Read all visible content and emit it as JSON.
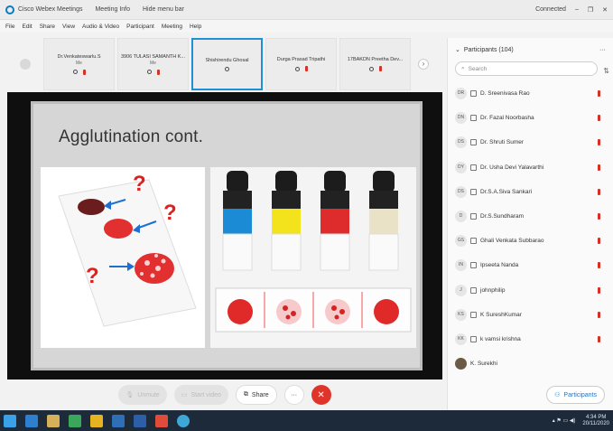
{
  "window": {
    "app_name": "Cisco Webex Meetings",
    "meeting_info": "Meeting Info",
    "hide_menu": "Hide menu bar",
    "status": "Connected"
  },
  "menu": [
    "File",
    "Edit",
    "Share",
    "View",
    "Audio & Video",
    "Participant",
    "Meeting",
    "Help"
  ],
  "filmstrip": [
    {
      "name": "Dr.Venkateswarlu.S",
      "sub": "Me"
    },
    {
      "name": "3906 TULASI SAMANTH K...",
      "sub": "Me"
    },
    {
      "name": "Shishirendu Ghosal",
      "sub": "",
      "active": true
    },
    {
      "name": "Durga Prasad Tripathi",
      "sub": ""
    },
    {
      "name": "17BAKDN Preetha Dev...",
      "sub": ""
    }
  ],
  "slide": {
    "title": "Agglutination cont."
  },
  "controls": {
    "unmute": "Unmute",
    "start_video": "Start video",
    "share": "Share"
  },
  "participants": {
    "header": "Participants (104)",
    "search_placeholder": "Search",
    "list": [
      {
        "initials": "DR",
        "name": "D. Sreenivasa Rao"
      },
      {
        "initials": "DN",
        "name": "Dr. Fazal Noorbasha"
      },
      {
        "initials": "DS",
        "name": "Dr. Shruti Sumer"
      },
      {
        "initials": "DY",
        "name": "Dr. Usha Devi Yalavarthi"
      },
      {
        "initials": "DS",
        "name": "Dr.S.A.Siva Sankari"
      },
      {
        "initials": "D",
        "name": "Dr.S.Sundharam"
      },
      {
        "initials": "GS",
        "name": "Ghali Venkata Subbarao"
      },
      {
        "initials": "IN",
        "name": "Ipseeta Nanda"
      },
      {
        "initials": "J",
        "name": "johnphilip"
      },
      {
        "initials": "KS",
        "name": "K SureshKumar"
      },
      {
        "initials": "KK",
        "name": "k vamsi krishna"
      },
      {
        "initials": "",
        "name": "K. Surekhi",
        "photo": true
      }
    ],
    "button": "Participants"
  },
  "taskbar": {
    "time": "4:34 PM",
    "date": "20/11/2020"
  }
}
